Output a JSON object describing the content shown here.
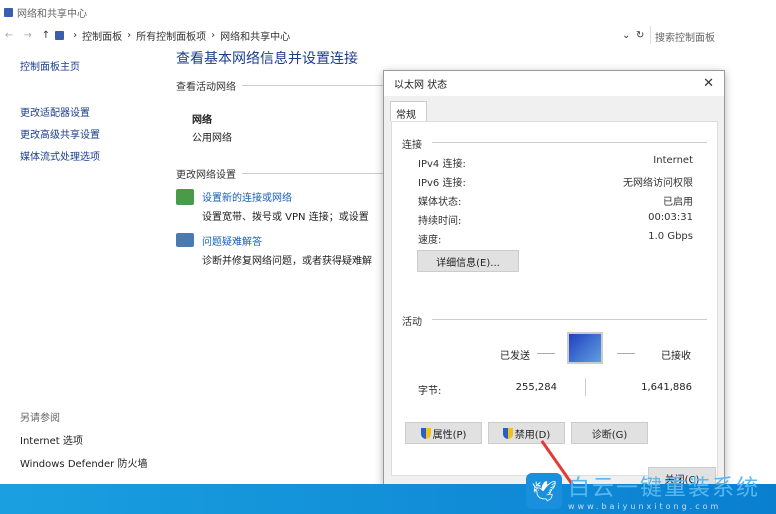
{
  "window": {
    "title": "网络和共享中心"
  },
  "address": {
    "crumbs": [
      "控制面板",
      "所有控制面板项",
      "网络和共享中心"
    ],
    "search_placeholder": "搜索控制面板"
  },
  "sidebar": {
    "items": [
      "控制面板主页",
      "更改适配器设置",
      "更改高级共享设置",
      "媒体流式处理选项"
    ],
    "see_also_title": "另请参阅",
    "see_also": [
      "Internet 选项",
      "Windows Defender 防火墙"
    ]
  },
  "main": {
    "title": "查看基本网络信息并设置连接",
    "active_section": "查看活动网络",
    "network_name": "网络",
    "network_type": "公用网络",
    "change_section": "更改网络设置",
    "tasks": [
      {
        "link": "设置新的连接或网络",
        "desc": "设置宽带、拨号或 VPN 连接；或设置"
      },
      {
        "link": "问题疑难解答",
        "desc": "诊断并修复网络问题，或者获得疑难解"
      }
    ]
  },
  "dialog": {
    "title": "以太网 状态",
    "tab": "常规",
    "connection_label": "连接",
    "rows": [
      {
        "k": "IPv4 连接:",
        "v": "Internet"
      },
      {
        "k": "IPv6 连接:",
        "v": "无网络访问权限"
      },
      {
        "k": "媒体状态:",
        "v": "已启用"
      },
      {
        "k": "持续时间:",
        "v": "00:03:31"
      },
      {
        "k": "速度:",
        "v": "1.0 Gbps"
      }
    ],
    "details_button": "详细信息(E)...",
    "activity_label": "活动",
    "sent": "已发送",
    "received": "已接收",
    "bytes_label": "字节:",
    "bytes_sent": "255,284",
    "bytes_received": "1,641,886",
    "properties_button": "属性(P)",
    "disable_button": "禁用(D)",
    "diagnose_button": "诊断(G)",
    "close_button": "关闭(C)"
  },
  "watermark": {
    "title": "白云一键重装系统",
    "url": "www.baiyunxitong.com"
  }
}
